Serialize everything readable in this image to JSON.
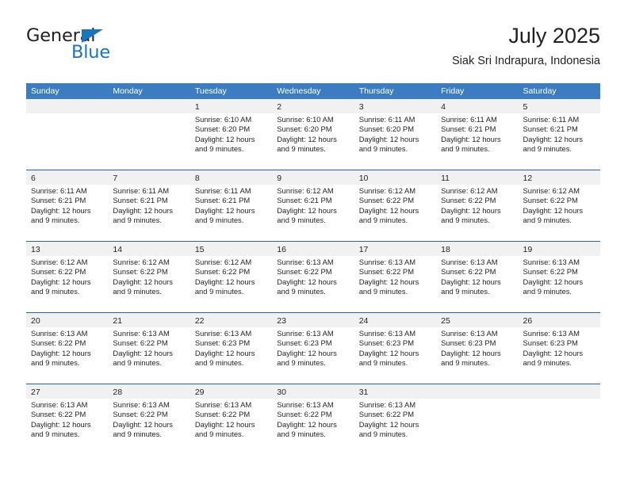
{
  "brand": {
    "name_part1": "General",
    "name_part2": "Blue",
    "triangle_icon": "triangle-icon",
    "accent_color": "#1b75bb"
  },
  "header": {
    "title": "July 2025",
    "subtitle": "Siak Sri Indrapura, Indonesia"
  },
  "theme": {
    "header_bg": "#3b7dc0",
    "row_rule": "#2463a8",
    "day_band_bg": "#f1f1f1",
    "text": "#231f20"
  },
  "weekdays": [
    "Sunday",
    "Monday",
    "Tuesday",
    "Wednesday",
    "Thursday",
    "Friday",
    "Saturday"
  ],
  "weeks": [
    [
      {
        "day": "",
        "lines": []
      },
      {
        "day": "",
        "lines": []
      },
      {
        "day": "1",
        "lines": [
          "Sunrise: 6:10 AM",
          "Sunset: 6:20 PM",
          "Daylight: 12 hours",
          "and 9 minutes."
        ]
      },
      {
        "day": "2",
        "lines": [
          "Sunrise: 6:10 AM",
          "Sunset: 6:20 PM",
          "Daylight: 12 hours",
          "and 9 minutes."
        ]
      },
      {
        "day": "3",
        "lines": [
          "Sunrise: 6:11 AM",
          "Sunset: 6:20 PM",
          "Daylight: 12 hours",
          "and 9 minutes."
        ]
      },
      {
        "day": "4",
        "lines": [
          "Sunrise: 6:11 AM",
          "Sunset: 6:21 PM",
          "Daylight: 12 hours",
          "and 9 minutes."
        ]
      },
      {
        "day": "5",
        "lines": [
          "Sunrise: 6:11 AM",
          "Sunset: 6:21 PM",
          "Daylight: 12 hours",
          "and 9 minutes."
        ]
      }
    ],
    [
      {
        "day": "6",
        "lines": [
          "Sunrise: 6:11 AM",
          "Sunset: 6:21 PM",
          "Daylight: 12 hours",
          "and 9 minutes."
        ]
      },
      {
        "day": "7",
        "lines": [
          "Sunrise: 6:11 AM",
          "Sunset: 6:21 PM",
          "Daylight: 12 hours",
          "and 9 minutes."
        ]
      },
      {
        "day": "8",
        "lines": [
          "Sunrise: 6:11 AM",
          "Sunset: 6:21 PM",
          "Daylight: 12 hours",
          "and 9 minutes."
        ]
      },
      {
        "day": "9",
        "lines": [
          "Sunrise: 6:12 AM",
          "Sunset: 6:21 PM",
          "Daylight: 12 hours",
          "and 9 minutes."
        ]
      },
      {
        "day": "10",
        "lines": [
          "Sunrise: 6:12 AM",
          "Sunset: 6:22 PM",
          "Daylight: 12 hours",
          "and 9 minutes."
        ]
      },
      {
        "day": "11",
        "lines": [
          "Sunrise: 6:12 AM",
          "Sunset: 6:22 PM",
          "Daylight: 12 hours",
          "and 9 minutes."
        ]
      },
      {
        "day": "12",
        "lines": [
          "Sunrise: 6:12 AM",
          "Sunset: 6:22 PM",
          "Daylight: 12 hours",
          "and 9 minutes."
        ]
      }
    ],
    [
      {
        "day": "13",
        "lines": [
          "Sunrise: 6:12 AM",
          "Sunset: 6:22 PM",
          "Daylight: 12 hours",
          "and 9 minutes."
        ]
      },
      {
        "day": "14",
        "lines": [
          "Sunrise: 6:12 AM",
          "Sunset: 6:22 PM",
          "Daylight: 12 hours",
          "and 9 minutes."
        ]
      },
      {
        "day": "15",
        "lines": [
          "Sunrise: 6:12 AM",
          "Sunset: 6:22 PM",
          "Daylight: 12 hours",
          "and 9 minutes."
        ]
      },
      {
        "day": "16",
        "lines": [
          "Sunrise: 6:13 AM",
          "Sunset: 6:22 PM",
          "Daylight: 12 hours",
          "and 9 minutes."
        ]
      },
      {
        "day": "17",
        "lines": [
          "Sunrise: 6:13 AM",
          "Sunset: 6:22 PM",
          "Daylight: 12 hours",
          "and 9 minutes."
        ]
      },
      {
        "day": "18",
        "lines": [
          "Sunrise: 6:13 AM",
          "Sunset: 6:22 PM",
          "Daylight: 12 hours",
          "and 9 minutes."
        ]
      },
      {
        "day": "19",
        "lines": [
          "Sunrise: 6:13 AM",
          "Sunset: 6:22 PM",
          "Daylight: 12 hours",
          "and 9 minutes."
        ]
      }
    ],
    [
      {
        "day": "20",
        "lines": [
          "Sunrise: 6:13 AM",
          "Sunset: 6:22 PM",
          "Daylight: 12 hours",
          "and 9 minutes."
        ]
      },
      {
        "day": "21",
        "lines": [
          "Sunrise: 6:13 AM",
          "Sunset: 6:22 PM",
          "Daylight: 12 hours",
          "and 9 minutes."
        ]
      },
      {
        "day": "22",
        "lines": [
          "Sunrise: 6:13 AM",
          "Sunset: 6:23 PM",
          "Daylight: 12 hours",
          "and 9 minutes."
        ]
      },
      {
        "day": "23",
        "lines": [
          "Sunrise: 6:13 AM",
          "Sunset: 6:23 PM",
          "Daylight: 12 hours",
          "and 9 minutes."
        ]
      },
      {
        "day": "24",
        "lines": [
          "Sunrise: 6:13 AM",
          "Sunset: 6:23 PM",
          "Daylight: 12 hours",
          "and 9 minutes."
        ]
      },
      {
        "day": "25",
        "lines": [
          "Sunrise: 6:13 AM",
          "Sunset: 6:23 PM",
          "Daylight: 12 hours",
          "and 9 minutes."
        ]
      },
      {
        "day": "26",
        "lines": [
          "Sunrise: 6:13 AM",
          "Sunset: 6:23 PM",
          "Daylight: 12 hours",
          "and 9 minutes."
        ]
      }
    ],
    [
      {
        "day": "27",
        "lines": [
          "Sunrise: 6:13 AM",
          "Sunset: 6:22 PM",
          "Daylight: 12 hours",
          "and 9 minutes."
        ]
      },
      {
        "day": "28",
        "lines": [
          "Sunrise: 6:13 AM",
          "Sunset: 6:22 PM",
          "Daylight: 12 hours",
          "and 9 minutes."
        ]
      },
      {
        "day": "29",
        "lines": [
          "Sunrise: 6:13 AM",
          "Sunset: 6:22 PM",
          "Daylight: 12 hours",
          "and 9 minutes."
        ]
      },
      {
        "day": "30",
        "lines": [
          "Sunrise: 6:13 AM",
          "Sunset: 6:22 PM",
          "Daylight: 12 hours",
          "and 9 minutes."
        ]
      },
      {
        "day": "31",
        "lines": [
          "Sunrise: 6:13 AM",
          "Sunset: 6:22 PM",
          "Daylight: 12 hours",
          "and 9 minutes."
        ]
      },
      {
        "day": "",
        "lines": []
      },
      {
        "day": "",
        "lines": []
      }
    ]
  ]
}
